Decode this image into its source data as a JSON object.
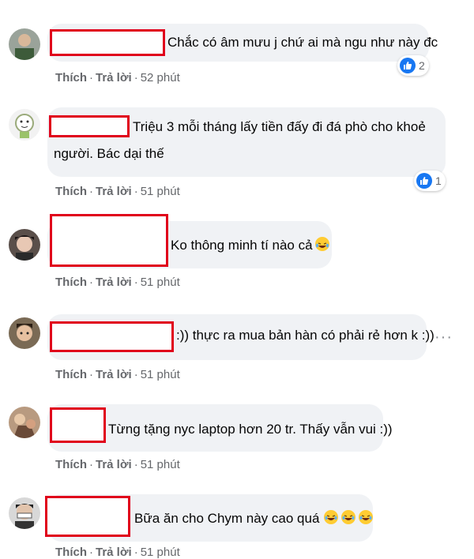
{
  "comments": [
    {
      "text_line1": "Chắc có âm mưu j chứ ai mà ngu như này đc",
      "text_line2": "",
      "actions": {
        "like": "Thích",
        "reply": "Trả lời",
        "time": "52 phút"
      },
      "reaction_count": "2",
      "avatar": "user-avatar"
    },
    {
      "text_line1": "Triệu 3 mỗi tháng lấy tiền đấy đi đá phò cho khoẻ",
      "text_line2": "người. Bác dại thế",
      "actions": {
        "like": "Thích",
        "reply": "Trả lời",
        "time": "51 phút"
      },
      "reaction_count": "1",
      "avatar": "user-avatar"
    },
    {
      "text_line1": "Ko thông minh tí nào cả",
      "text_line2": "",
      "actions": {
        "like": "Thích",
        "reply": "Trả lời",
        "time": "51 phút"
      },
      "reaction_count": "",
      "emoji": "rolling-laughing-emoji",
      "avatar": "user-avatar"
    },
    {
      "text_line1": ":)) thực ra mua bản hàn có phải rẻ hơn k :))",
      "text_line2": "",
      "actions": {
        "like": "Thích",
        "reply": "Trả lời",
        "time": "51 phút"
      },
      "reaction_count": "",
      "more_icon": "more-dots-icon",
      "avatar": "user-avatar"
    },
    {
      "text_line1": "Từng tặng nyc laptop hơn 20 tr. Thấy vẫn vui :))",
      "text_line2": "",
      "actions": {
        "like": "Thích",
        "reply": "Trả lời",
        "time": "51 phút"
      },
      "reaction_count": "",
      "avatar": "user-avatar"
    },
    {
      "text_line1": "Bữa ăn cho Chym này cao quá",
      "text_line2": "",
      "actions": {
        "like": "Thích",
        "reply": "Trả lời",
        "time": "51 phút"
      },
      "reaction_count": "",
      "emoji": "crying-laughing-emoji",
      "avatar": "user-avatar"
    }
  ],
  "colors": {
    "bubble": "#f0f2f5",
    "redaction_border": "#e0001b",
    "meta_text": "#65676b",
    "like_blue": "#1877f2"
  }
}
